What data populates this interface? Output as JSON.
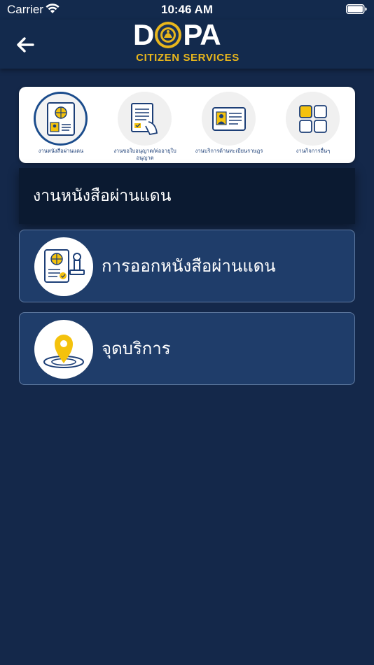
{
  "status_bar": {
    "carrier": "Carrier",
    "time": "10:46 AM",
    "wifi_icon": "wifi-icon",
    "battery_icon": "battery-icon"
  },
  "nav": {
    "back_icon": "arrow-left-icon",
    "logo_text_left": "D",
    "logo_text_right": "PA",
    "logo_subtitle": "CITIZEN SERVICES"
  },
  "categories": [
    {
      "label": "งานหนังสือผ่านแดน",
      "icon": "passport-icon",
      "active": true
    },
    {
      "label": "งานขอใบอนุญาต/ต่ออายุใบอนุญาต",
      "icon": "license-form-icon",
      "active": false
    },
    {
      "label": "งานบริการด้านทะเบียนราษฎร",
      "icon": "id-card-icon",
      "active": false
    },
    {
      "label": "งานกิจการอื่นๆ",
      "icon": "grid-apps-icon",
      "active": false
    }
  ],
  "section": {
    "title": "งานหนังสือผ่านแดน"
  },
  "services": [
    {
      "label": "การออกหนังสือผ่านแดน",
      "icon": "stamped-passport-icon"
    },
    {
      "label": "จุดบริการ",
      "icon": "location-pin-icon"
    }
  ],
  "colors": {
    "background": "#14284a",
    "nav": "#132a4d",
    "accent_gold": "#e8b61c",
    "card_blue": "#1f3d6a",
    "label_blue": "#1d3f77"
  }
}
